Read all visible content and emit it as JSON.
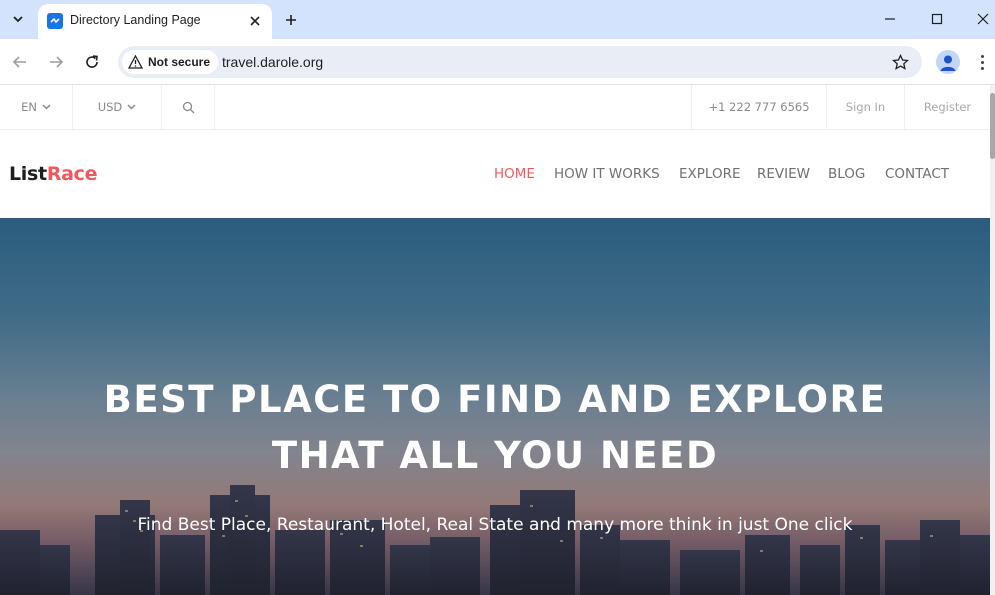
{
  "browser": {
    "tab_title": "Directory Landing Page",
    "security_label": "Not secure",
    "url": "travel.darole.org"
  },
  "topbar": {
    "language": "EN",
    "currency": "USD",
    "phone": "+1 222 777 6565",
    "sign_in": "Sign In",
    "register": "Register"
  },
  "navbar": {
    "logo_part1": "List",
    "logo_part2": "Race",
    "links": [
      "HOME",
      "HOW IT WORKS",
      "EXPLORE",
      "REVIEW",
      "BLOG",
      "CONTACT"
    ]
  },
  "hero": {
    "title_line1": "BEST PLACE TO FIND AND EXPLORE",
    "title_line2": "THAT ALL YOU NEED",
    "subtitle": "Find Best Place, Restaurant, Hotel, Real State and many more think in just One click"
  },
  "colors": {
    "accent": "#f1585d",
    "browser_tabbar": "#d3e3fd"
  }
}
